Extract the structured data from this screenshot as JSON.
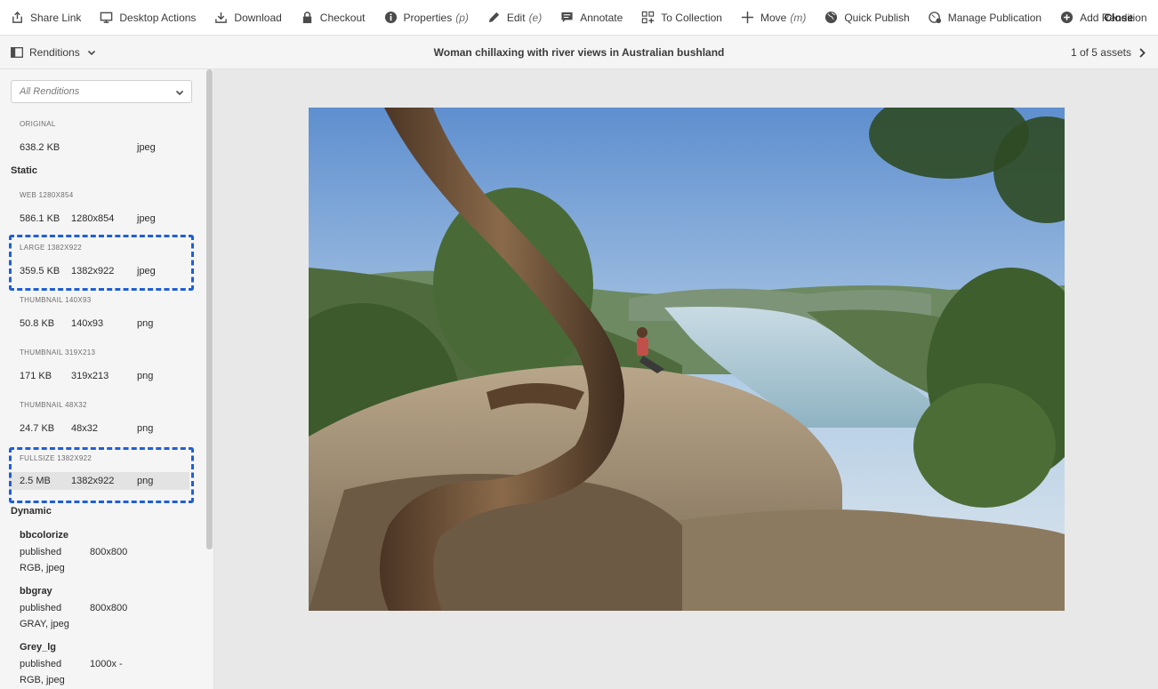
{
  "toolbar": {
    "items": [
      {
        "label": "Share Link",
        "key": "",
        "icon": "share-icon"
      },
      {
        "label": "Desktop Actions",
        "key": "",
        "icon": "desktop-icon"
      },
      {
        "label": "Download",
        "key": "",
        "icon": "download-icon"
      },
      {
        "label": "Checkout",
        "key": "",
        "icon": "lock-icon"
      },
      {
        "label": "Properties",
        "key": "(p)",
        "icon": "info-icon"
      },
      {
        "label": "Edit",
        "key": "(e)",
        "icon": "pencil-icon"
      },
      {
        "label": "Annotate",
        "key": "",
        "icon": "annotate-icon"
      },
      {
        "label": "To Collection",
        "key": "",
        "icon": "collection-icon"
      },
      {
        "label": "Move",
        "key": "(m)",
        "icon": "move-icon"
      },
      {
        "label": "Quick Publish",
        "key": "",
        "icon": "globe-icon"
      },
      {
        "label": "Manage Publication",
        "key": "",
        "icon": "manage-publication-icon"
      },
      {
        "label": "Add Rendition",
        "key": "",
        "icon": "add-circle-icon"
      }
    ],
    "more": "•••",
    "close_label": "Close"
  },
  "subbar": {
    "renditions_label": "Renditions",
    "title": "Woman chillaxing with river views in Australian bushland",
    "counter": "1 of 5 assets"
  },
  "sidebar": {
    "filter_value": "All Renditions",
    "original": {
      "label": "ORIGINAL",
      "size": "638.2 KB",
      "dims": "",
      "format": "jpeg"
    },
    "static_heading": "Static",
    "static": [
      {
        "label": "WEB 1280X854",
        "size": "586.1 KB",
        "dims": "1280x854",
        "format": "jpeg"
      },
      {
        "label": "LARGE 1382X922",
        "size": "359.5 KB",
        "dims": "1382x922",
        "format": "jpeg"
      },
      {
        "label": "THUMBNAIL 140X93",
        "size": "50.8 KB",
        "dims": "140x93",
        "format": "png"
      },
      {
        "label": "THUMBNAIL 319X213",
        "size": "171 KB",
        "dims": "319x213",
        "format": "png"
      },
      {
        "label": "THUMBNAIL 48X32",
        "size": "24.7 KB",
        "dims": "48x32",
        "format": "png"
      },
      {
        "label": "FULLSIZE 1382X922",
        "size": "2.5 MB",
        "dims": "1382x922",
        "format": "png"
      }
    ],
    "dynamic_heading": "Dynamic",
    "dynamic": [
      {
        "name": "bbcolorize",
        "status": "published",
        "dims": "800x800",
        "mode": "RGB, jpeg"
      },
      {
        "name": "bbgray",
        "status": "published",
        "dims": "800x800",
        "mode": "GRAY, jpeg"
      },
      {
        "name": "Grey_lg",
        "status": "published",
        "dims": "1000x -",
        "mode": "RGB, jpeg"
      }
    ]
  },
  "colors": {
    "highlight": "#1f5fd6",
    "sidebar_bg": "#f5f5f5",
    "canvas_bg": "#e8e8e8"
  }
}
